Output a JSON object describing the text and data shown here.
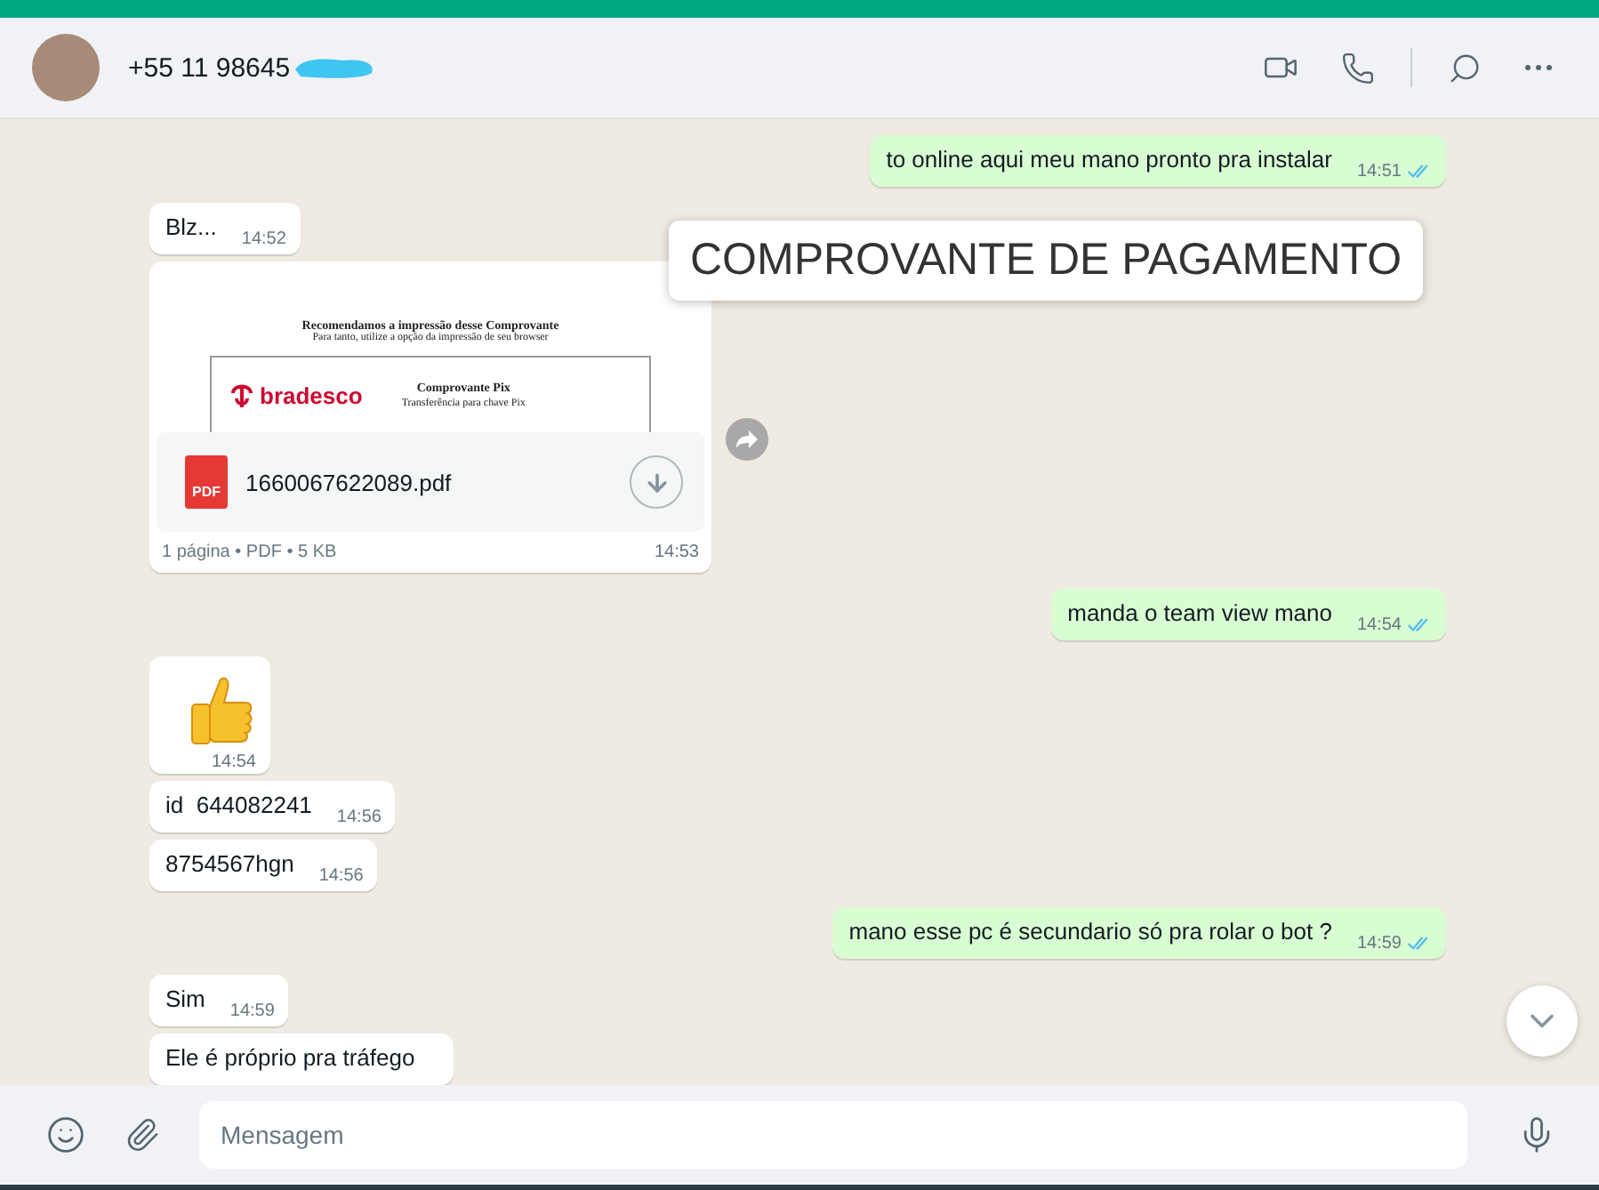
{
  "header": {
    "contact": "+55 11 98645"
  },
  "overlay_label": "COMPROVANTE DE PAGAMENTO",
  "messages": [
    {
      "kind": "text",
      "outgoing": true,
      "text": "to online aqui meu mano pronto pra instalar",
      "time": "14:51",
      "read": true
    },
    {
      "kind": "text",
      "outgoing": false,
      "text": "Blz...",
      "time": "14:52"
    },
    {
      "kind": "document",
      "outgoing": false,
      "preview": {
        "heading": "Recomendamos a impressão desse Comprovante",
        "subheading": "Para tanto, utilize a opção da impressão de seu browser",
        "bank": "bradesco",
        "title": "Comprovante Pix",
        "subtitle": "Transferência para chave Pix"
      },
      "file_badge": "PDF",
      "file_name": "1660067622089.pdf",
      "meta": "1 página • PDF • 5 KB",
      "time": "14:53"
    },
    {
      "kind": "text",
      "outgoing": true,
      "text": "manda o team view mano",
      "time": "14:54",
      "read": true
    },
    {
      "kind": "emoji",
      "outgoing": false,
      "time": "14:54"
    },
    {
      "kind": "text",
      "outgoing": false,
      "text": "id  644082241",
      "time": "14:56"
    },
    {
      "kind": "text",
      "outgoing": false,
      "text": "8754567hgn",
      "time": "14:56"
    },
    {
      "kind": "text",
      "outgoing": true,
      "text": "mano esse pc é secundario só pra rolar o bot ?",
      "time": "14:59",
      "read": true
    },
    {
      "kind": "text",
      "outgoing": false,
      "text": "Sim",
      "time": "14:59"
    },
    {
      "kind": "text",
      "outgoing": false,
      "text": "Ele é próprio pra tráfego"
    }
  ],
  "composer": {
    "placeholder": "Mensagem"
  }
}
